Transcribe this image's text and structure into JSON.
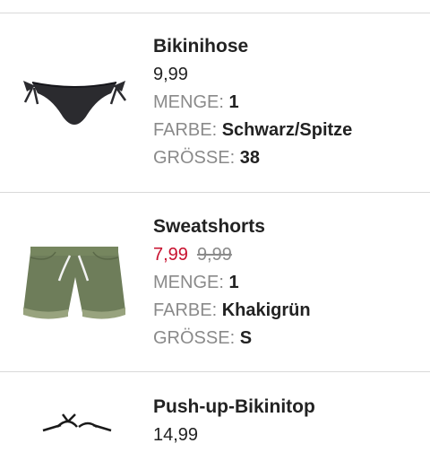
{
  "labels": {
    "quantity": "MENGE:",
    "color": "FARBE:",
    "size": "GRÖSSE:"
  },
  "items": [
    {
      "name": "Bikinihose",
      "price": "9,99",
      "sale_price": "",
      "quantity": "1",
      "color": "Schwarz/Spitze",
      "size": "38",
      "image_icon": "bikini-bottom-black-lace-image"
    },
    {
      "name": "Sweatshorts",
      "price": "9,99",
      "sale_price": "7,99",
      "quantity": "1",
      "color": "Khakigrün",
      "size": "S",
      "image_icon": "khaki-sweatshorts-image"
    },
    {
      "name": "Push-up-Bikinitop",
      "price": "14,99",
      "image_icon": "bikini-top-image"
    }
  ],
  "colors": {
    "sale": "#c8102e",
    "muted": "#8a8a8a",
    "text": "#222222",
    "divider": "#d9d9d9",
    "khaki": "#6e7d5a"
  }
}
